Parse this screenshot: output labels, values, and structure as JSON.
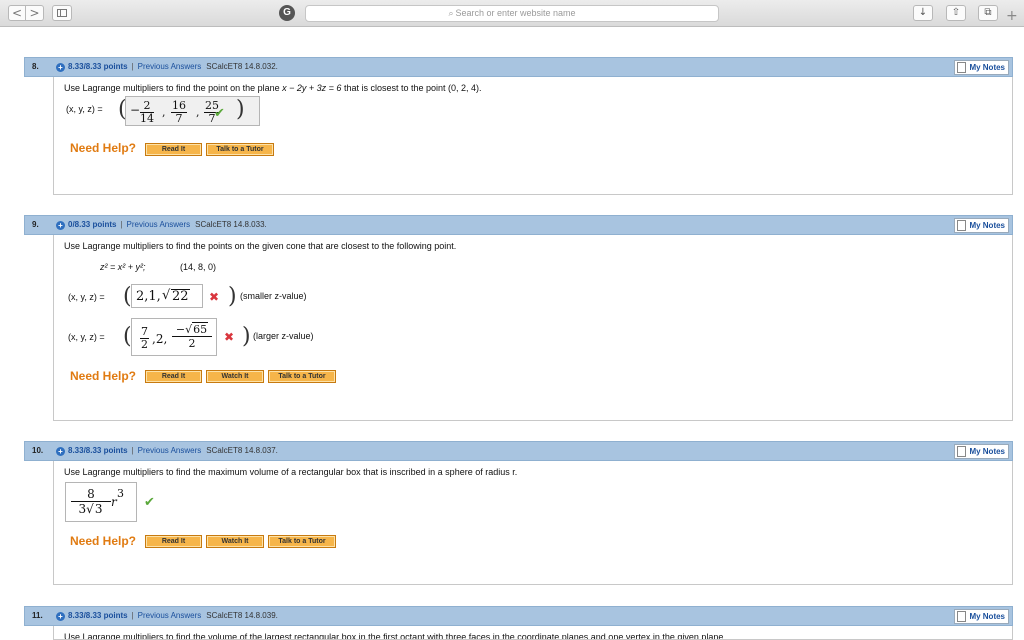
{
  "browser": {
    "back": "<",
    "forward": ">",
    "ext_glyph": "G",
    "search_placeholder": "Search or enter website name",
    "download_glyph": "↓",
    "share_glyph": "⇧",
    "tabs_glyph": "⧉",
    "newtab_glyph": "+"
  },
  "common": {
    "prev_answers": "Previous Answers",
    "my_notes": "My Notes",
    "need_help": "Need Help?",
    "read_it": "Read It",
    "watch_it": "Watch It",
    "talk_tutor": "Talk to a Tutor",
    "sep": "|",
    "check": "✔",
    "cross": "✖"
  },
  "q8": {
    "num": "8.",
    "points": "8.33/8.33 points",
    "code": "SCalcET8 14.8.032.",
    "text_a": "Use Lagrange multipliers to find the point on the plane ",
    "text_eq": "x − 2y + 3z = 6",
    "text_b": " that is closest to the point ",
    "text_pt": "(0, 2, 4).",
    "label": "(x, y, z) =",
    "minus": "−",
    "n1": "2",
    "d1": "14",
    "n2": "16",
    "d2": "7",
    "n3": "25",
    "d3": "7",
    "comma": ","
  },
  "q9": {
    "num": "9.",
    "points": "0/8.33 points",
    "code": "SCalcET8 14.8.033.",
    "text": "Use Lagrange multipliers to find the points on the given cone that are closest to the following point.",
    "cone": "z² = x² + y²;",
    "point": "(14, 8, 0)",
    "label1": "(x, y, z) =",
    "ans1_a": "2,1,",
    "ans1_rad": "22",
    "hint1": "(smaller z-value)",
    "label2": "(x, y, z) =",
    "ans2_n1": "7",
    "ans2_d1": "2",
    "ans2_mid": ",2,",
    "ans2_n2_sign": "−",
    "ans2_n2_rad": "65",
    "ans2_d2": "2",
    "hint2": "(larger z-value)"
  },
  "q10": {
    "num": "10.",
    "points": "8.33/8.33 points",
    "code": "SCalcET8 14.8.037.",
    "text": "Use Lagrange multipliers to find the maximum volume of a rectangular box that is inscribed in a sphere of radius r.",
    "num_val": "8",
    "den_coef": "3",
    "den_rad": "3",
    "var": "r",
    "exp": "3"
  },
  "q11": {
    "num": "11.",
    "points": "8.33/8.33 points",
    "code": "SCalcET8 14.8.039.",
    "text": "Use Lagrange multipliers to find the volume of the largest rectangular box in the first octant with three faces in the coordinate planes and one vertex in the given plane."
  }
}
